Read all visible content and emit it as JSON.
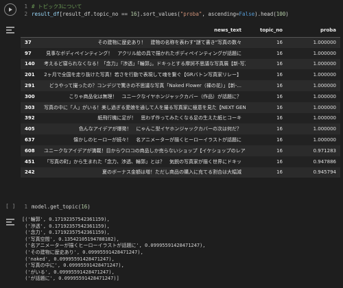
{
  "cell1": {
    "line_numbers": [
      "1",
      "2"
    ],
    "comment": "# トピック3について",
    "code_var": "result_df",
    "code_mid": "[result_df.topic_no == ",
    "code_num": "16",
    "code_after_num": "].sort_values(",
    "code_str": "\"proba\"",
    "code_comma": ", ascending=",
    "code_kw": "False",
    "code_head": ").head(",
    "code_num2": "100",
    "code_end": ")"
  },
  "dataframe": {
    "columns": [
      "",
      "news_text",
      "topic_no",
      "proba"
    ],
    "rows": [
      {
        "idx": "37",
        "text": "その建物に歴史あり！　建物の名称を表わす\"謎て書き\"写真の数々",
        "topic": "16",
        "proba": "1.000000"
      },
      {
        "idx": "97",
        "text": "見事なボディペインティング！　アクリル絵の具で描かれたボディペインティングが話題に",
        "topic": "16",
        "proba": "1.000000"
      },
      {
        "idx": "140",
        "text": "考えるど寝られなくなる！「念力」「渉透」「輪郭」。ドキっとする摩訶不思議な写真展【新-写真空間】",
        "topic": "16",
        "proba": "1.000000"
      },
      {
        "idx": "201",
        "text": "2ヶ月で全国を走り抜けた写真！若さを行動で表現して魂を繋ぐ【GRバトン写真家リレー】",
        "topic": "16",
        "proba": "1.000000"
      },
      {
        "idx": "291",
        "text": "どうやって撮ったの？コンデジで驚きの不思議な写真「Naked Flower（裸の花）」【新-...",
        "topic": "16",
        "proba": "1.000000"
      },
      {
        "idx": "300",
        "text": "こりゃ商品化は無理！　ユニークなイヤホンジャックカバー（作品）が話題に？",
        "topic": "16",
        "proba": "1.000000"
      },
      {
        "idx": "303",
        "text": "写真の中に「人」がいる！美し過ぎる愛娘を通して人を撮る写真家に極意を見た【NEXT GENE...",
        "topic": "16",
        "proba": "1.000000"
      },
      {
        "idx": "392",
        "text": "紙飛行機に足が！　思わず作ってみたくなる足の生えた紙ヒコーキ",
        "topic": "16",
        "proba": "1.000000"
      },
      {
        "idx": "405",
        "text": "色んなアイデアが爆発！　にゃんこ型イヤホンジャックカバーの次は何だ？",
        "topic": "16",
        "proba": "1.000000"
      },
      {
        "idx": "637",
        "text": "懐かしのヒーローが続々！　名アニメーターが描くヒーローイラストが話題に",
        "topic": "16",
        "proba": "1.000000"
      },
      {
        "idx": "608",
        "text": "ユニークなアイデアが満載！目からウロコの商品しか売らないショップ【イケショップのレア物】",
        "topic": "16",
        "proba": "0.971283"
      },
      {
        "idx": "451",
        "text": "「写真の町」から生まれた「念力、渉透、輪郭」とは？　気鋭の写真家が描く世界にドキッ",
        "topic": "16",
        "proba": "0.947886"
      },
      {
        "idx": "242",
        "text": "夏のボーナス金額は増！ただし商品の購入に充てる割合は大幅減",
        "topic": "16",
        "proba": "0.945794"
      }
    ]
  },
  "cell2": {
    "bracket": "[ ]",
    "line_number": "1",
    "code": "model.get_topic(",
    "arg": "16",
    "end": ")"
  },
  "output2": {
    "lines": [
      "[('輪郭', 0.17192357542361159),",
      " ('渉透', 0.17192357542361159),",
      " ('念力', 0.17192357542361159),",
      " ('写真空間', 0.13542105194788182),",
      " ('名アニメーターが描くヒーローイラストが話題に', 0.09995591428471247),",
      " ('その建物に歴史あり', 0.09995591428471247),",
      " ('naked', 0.09995591428471247),",
      " ('写真の中に', 0.09995591428471247),",
      " ('がいる', 0.09995591428471247),",
      " ('が話題に', 0.09995591428471247)]"
    ]
  }
}
